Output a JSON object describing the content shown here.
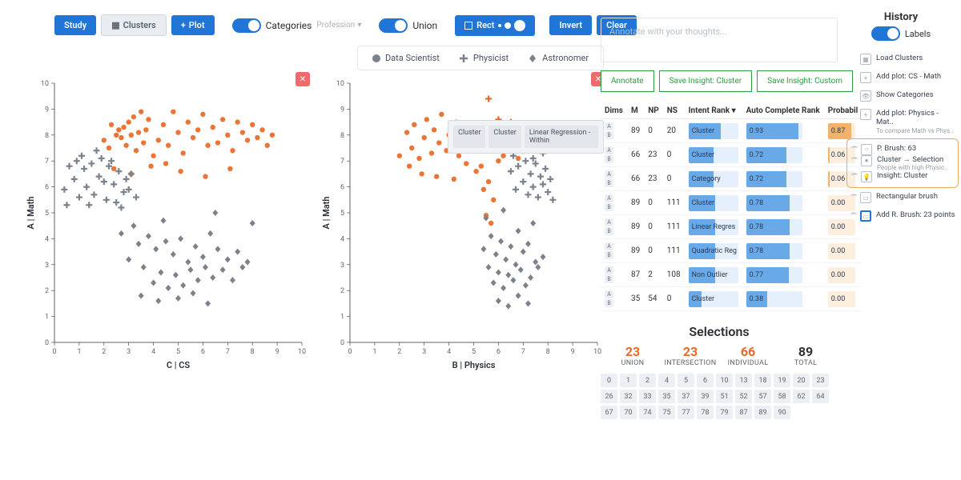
{
  "toolbar": {
    "study": "Study",
    "clusters": "Clusters",
    "plot": "Plot",
    "categories": "Categories",
    "profession": "Profession",
    "union": "Union",
    "rect": "Rect",
    "invert": "Invert",
    "clear": "Clear"
  },
  "legend": {
    "ds": "Data Scientist",
    "phys": "Physicist",
    "astro": "Astronomer"
  },
  "plots": {
    "left": {
      "ylabel": "A | Math",
      "xlabel": "C | CS"
    },
    "right": {
      "ylabel": "A | Math",
      "xlabel": "B | Physics"
    }
  },
  "plotTip": {
    "b1": "Cluster",
    "b2": "Cluster",
    "b3": "Linear Regression - Within"
  },
  "annotate": {
    "placeholder": "Annotate with your thoughts...",
    "b1": "Annotate",
    "b2": "Save Insight: Cluster",
    "b3": "Save Insight: Custom"
  },
  "tableHeaders": {
    "dims": "Dims",
    "m": "M",
    "np": "NP",
    "ns": "NS",
    "intent": "Intent Rank",
    "auto": "Auto Complete Rank",
    "prob": "Probabil"
  },
  "rows": [
    {
      "m": 89,
      "np": 0,
      "ns": 20,
      "intent": "Cluster",
      "auto": 0.93,
      "prob": 0.87
    },
    {
      "m": 66,
      "np": 23,
      "ns": 0,
      "intent": "Cluster",
      "auto": 0.72,
      "prob": 0.06
    },
    {
      "m": 66,
      "np": 23,
      "ns": 0,
      "intent": "Category",
      "auto": 0.72,
      "prob": 0.06
    },
    {
      "m": 89,
      "np": 0,
      "ns": 111,
      "intent": "Cluster",
      "auto": 0.78,
      "prob": 0.0
    },
    {
      "m": 89,
      "np": 0,
      "ns": 111,
      "intent": "Linear Regres",
      "auto": 0.78,
      "prob": 0.0
    },
    {
      "m": 89,
      "np": 0,
      "ns": 111,
      "intent": "Quadratic Reg",
      "auto": 0.78,
      "prob": 0.0
    },
    {
      "m": 87,
      "np": 2,
      "ns": 108,
      "intent": "Non Outlier",
      "auto": 0.77,
      "prob": 0.0
    },
    {
      "m": 35,
      "np": 54,
      "ns": 0,
      "intent": "Cluster",
      "auto": 0.38,
      "prob": 0.0
    }
  ],
  "selections": {
    "title": "Selections",
    "union": {
      "n": 23,
      "l": "UNION"
    },
    "intersection": {
      "n": 23,
      "l": "INTERSECTION"
    },
    "individual": {
      "n": 66,
      "l": "INDIVIDUAL"
    },
    "total": {
      "n": 89,
      "l": "TOTAL"
    }
  },
  "ids": [
    0,
    1,
    2,
    4,
    5,
    6,
    10,
    13,
    18,
    19,
    20,
    23,
    26,
    32,
    33,
    35,
    37,
    39,
    51,
    52,
    57,
    58,
    62,
    64,
    67,
    70,
    74,
    75,
    77,
    78,
    79,
    87,
    89,
    90
  ],
  "history": {
    "title": "History",
    "labels": "Labels",
    "items": [
      {
        "label": "Load Clusters",
        "sub": ""
      },
      {
        "label": "Add plot: CS - Math",
        "sub": ""
      },
      {
        "label": "Show Categories",
        "sub": ""
      },
      {
        "label": "Add plot: Physics - Mat..",
        "sub": "To compare Math vs Phys.."
      },
      {
        "label": "P. Brush: 63",
        "sub": ""
      },
      {
        "label": "Cluster → Selection",
        "sub": "People with high Physic.."
      },
      {
        "label": "Insight: Cluster",
        "sub": ""
      },
      {
        "label": "Rectangular brush",
        "sub": ""
      },
      {
        "label": "Add R. Brush: 23 points",
        "sub": ""
      }
    ]
  },
  "chart_data": [
    {
      "type": "scatter",
      "title": "",
      "xlabel": "C | CS",
      "ylabel": "A | Math",
      "xlim": [
        0,
        10
      ],
      "ylim": [
        0,
        10
      ],
      "series": [
        {
          "name": "Data Scientist",
          "glyph": "circle",
          "color": "#e96926",
          "selected": true,
          "points": [
            [
              2.2,
              7.5
            ],
            [
              2.5,
              8.0
            ],
            [
              2.6,
              8.2
            ],
            [
              2.7,
              7.9
            ],
            [
              2.8,
              8.3
            ],
            [
              2.9,
              7.6
            ],
            [
              3.0,
              8.5
            ],
            [
              3.1,
              8.0
            ],
            [
              3.2,
              8.7
            ],
            [
              3.3,
              7.4
            ],
            [
              3.4,
              8.1
            ],
            [
              3.5,
              8.9
            ],
            [
              3.6,
              7.7
            ],
            [
              3.7,
              8.2
            ],
            [
              3.8,
              8.6
            ],
            [
              4.0,
              7.2
            ],
            [
              4.2,
              7.8
            ],
            [
              4.4,
              8.4
            ],
            [
              4.6,
              7.6
            ],
            [
              4.8,
              8.9
            ],
            [
              5.0,
              8.1
            ],
            [
              5.2,
              7.3
            ],
            [
              5.4,
              8.5
            ],
            [
              5.6,
              7.9
            ],
            [
              5.8,
              8.2
            ],
            [
              6.0,
              8.8
            ],
            [
              6.2,
              7.6
            ],
            [
              6.4,
              8.3
            ],
            [
              6.6,
              7.7
            ],
            [
              6.8,
              8.6
            ],
            [
              7.0,
              8.0
            ],
            [
              7.2,
              7.4
            ],
            [
              7.4,
              8.5
            ],
            [
              7.6,
              8.1
            ],
            [
              7.8,
              7.8
            ],
            [
              8.0,
              8.4
            ],
            [
              8.2,
              7.9
            ],
            [
              8.4,
              8.2
            ],
            [
              8.6,
              7.6
            ],
            [
              3.9,
              6.8
            ],
            [
              3.1,
              6.5
            ],
            [
              2.4,
              6.7
            ],
            [
              5.1,
              6.6
            ],
            [
              6.1,
              6.4
            ],
            [
              7.1,
              6.7
            ],
            [
              4.5,
              6.9
            ],
            [
              2.0,
              7.8
            ],
            [
              2.3,
              8.4
            ],
            [
              8.8,
              8.0
            ]
          ]
        },
        {
          "name": "Physicist",
          "glyph": "plus",
          "color": "#7b828c",
          "selected": false,
          "points": [
            [
              0.4,
              5.9
            ],
            [
              0.8,
              6.3
            ],
            [
              1.0,
              5.6
            ],
            [
              1.2,
              6.7
            ],
            [
              1.3,
              6.0
            ],
            [
              1.5,
              6.9
            ],
            [
              1.6,
              5.7
            ],
            [
              1.8,
              6.4
            ],
            [
              1.9,
              7.1
            ],
            [
              2.0,
              6.2
            ],
            [
              2.1,
              5.5
            ],
            [
              2.2,
              6.8
            ],
            [
              2.4,
              6.1
            ],
            [
              2.5,
              5.4
            ],
            [
              2.6,
              6.6
            ],
            [
              2.8,
              5.8
            ],
            [
              2.9,
              6.3
            ],
            [
              3.0,
              5.9
            ],
            [
              3.1,
              6.5
            ],
            [
              3.3,
              5.6
            ],
            [
              0.6,
              6.8
            ],
            [
              1.1,
              7.2
            ],
            [
              1.4,
              5.3
            ],
            [
              1.7,
              7.4
            ],
            [
              2.3,
              7.0
            ],
            [
              2.7,
              5.2
            ],
            [
              0.5,
              5.3
            ],
            [
              0.9,
              7.0
            ]
          ]
        },
        {
          "name": "Astronomer",
          "glyph": "diamond",
          "color": "#7b828c",
          "selected": false,
          "points": [
            [
              2.7,
              4.2
            ],
            [
              3.0,
              3.2
            ],
            [
              3.2,
              4.5
            ],
            [
              3.4,
              3.8
            ],
            [
              3.6,
              2.9
            ],
            [
              3.8,
              4.1
            ],
            [
              4.0,
              2.3
            ],
            [
              4.1,
              3.6
            ],
            [
              4.3,
              2.7
            ],
            [
              4.5,
              3.9
            ],
            [
              4.6,
              2.1
            ],
            [
              4.8,
              3.4
            ],
            [
              4.9,
              2.6
            ],
            [
              5.1,
              4.0
            ],
            [
              5.2,
              2.2
            ],
            [
              5.4,
              3.1
            ],
            [
              5.5,
              2.8
            ],
            [
              5.7,
              3.7
            ],
            [
              5.8,
              2.4
            ],
            [
              6.0,
              3.3
            ],
            [
              6.1,
              2.9
            ],
            [
              6.3,
              4.2
            ],
            [
              6.4,
              2.5
            ],
            [
              6.6,
              3.6
            ],
            [
              6.8,
              2.8
            ],
            [
              7.0,
              3.2
            ],
            [
              7.2,
              2.4
            ],
            [
              7.4,
              3.5
            ],
            [
              7.6,
              2.9
            ],
            [
              7.8,
              3.1
            ],
            [
              8.0,
              4.6
            ],
            [
              3.5,
              1.8
            ],
            [
              4.2,
              1.6
            ],
            [
              5.0,
              1.7
            ],
            [
              5.6,
              1.9
            ],
            [
              6.2,
              1.5
            ],
            [
              4.4,
              4.7
            ],
            [
              6.5,
              5.0
            ]
          ]
        }
      ]
    },
    {
      "type": "scatter",
      "title": "",
      "xlabel": "B | Physics",
      "ylabel": "A | Math",
      "xlim": [
        0,
        10
      ],
      "ylim": [
        0,
        10
      ],
      "series": [
        {
          "name": "Data Scientist",
          "glyph": "circle",
          "color": "#e96926",
          "selected": true,
          "points": [
            [
              2.0,
              7.2
            ],
            [
              2.3,
              8.1
            ],
            [
              2.5,
              7.5
            ],
            [
              2.6,
              8.4
            ],
            [
              2.8,
              7.1
            ],
            [
              3.0,
              7.9
            ],
            [
              3.1,
              8.6
            ],
            [
              3.3,
              7.3
            ],
            [
              3.4,
              8.2
            ],
            [
              3.6,
              7.7
            ],
            [
              3.7,
              8.8
            ],
            [
              3.9,
              7.4
            ],
            [
              4.0,
              8.0
            ],
            [
              4.1,
              7.6
            ],
            [
              4.3,
              8.5
            ],
            [
              4.4,
              7.2
            ],
            [
              4.6,
              8.3
            ],
            [
              4.7,
              6.9
            ],
            [
              4.9,
              7.8
            ],
            [
              5.0,
              8.1
            ],
            [
              5.1,
              6.6
            ],
            [
              5.2,
              7.5
            ],
            [
              5.3,
              6.8
            ],
            [
              5.4,
              5.9
            ],
            [
              5.5,
              4.9
            ],
            [
              5.6,
              6.2
            ],
            [
              5.8,
              5.5
            ],
            [
              6.0,
              7.0
            ],
            [
              6.1,
              7.6
            ],
            [
              6.2,
              7.2
            ],
            [
              6.3,
              8.0
            ],
            [
              6.4,
              7.4
            ],
            [
              6.5,
              7.8
            ],
            [
              6.7,
              8.3
            ],
            [
              6.8,
              7.1
            ],
            [
              2.4,
              6.8
            ],
            [
              2.9,
              6.5
            ],
            [
              3.5,
              6.4
            ],
            [
              4.2,
              6.3
            ],
            [
              5.7,
              4.6
            ]
          ]
        },
        {
          "name": "Physicist",
          "glyph": "plus",
          "color": "#7b828c",
          "selected": false,
          "points": [
            [
              6.5,
              6.6
            ],
            [
              6.7,
              5.9
            ],
            [
              6.8,
              6.8
            ],
            [
              7.0,
              6.2
            ],
            [
              7.1,
              7.0
            ],
            [
              7.2,
              5.7
            ],
            [
              7.3,
              6.5
            ],
            [
              7.4,
              6.0
            ],
            [
              7.5,
              6.9
            ],
            [
              7.6,
              5.6
            ],
            [
              7.7,
              6.4
            ],
            [
              7.8,
              6.1
            ],
            [
              7.9,
              6.7
            ],
            [
              8.0,
              5.8
            ],
            [
              8.1,
              6.3
            ],
            [
              8.2,
              5.5
            ],
            [
              6.6,
              7.2
            ],
            [
              7.0,
              7.4
            ],
            [
              7.4,
              7.1
            ],
            [
              7.8,
              7.3
            ]
          ]
        },
        {
          "name": "Physicist-selected",
          "glyph": "plus",
          "color": "#e96926",
          "selected": true,
          "points": [
            [
              5.6,
              9.4
            ],
            [
              5.8,
              8.2
            ],
            [
              6.0,
              8.6
            ],
            [
              6.1,
              8.0
            ],
            [
              6.2,
              8.4
            ],
            [
              6.4,
              8.1
            ],
            [
              6.5,
              8.5
            ],
            [
              6.6,
              7.9
            ]
          ]
        },
        {
          "name": "Astronomer",
          "glyph": "diamond",
          "color": "#7b828c",
          "selected": false,
          "points": [
            [
              5.4,
              3.6
            ],
            [
              5.6,
              2.9
            ],
            [
              5.7,
              4.1
            ],
            [
              5.8,
              2.3
            ],
            [
              5.9,
              3.4
            ],
            [
              6.0,
              2.7
            ],
            [
              6.1,
              3.9
            ],
            [
              6.2,
              2.1
            ],
            [
              6.3,
              3.2
            ],
            [
              6.4,
              2.6
            ],
            [
              6.5,
              3.7
            ],
            [
              6.6,
              2.4
            ],
            [
              6.7,
              3.0
            ],
            [
              6.8,
              4.3
            ],
            [
              6.9,
              2.8
            ],
            [
              7.0,
              3.5
            ],
            [
              7.1,
              2.2
            ],
            [
              7.2,
              3.8
            ],
            [
              7.3,
              2.5
            ],
            [
              7.4,
              4.6
            ],
            [
              7.5,
              3.1
            ],
            [
              7.6,
              2.9
            ],
            [
              7.8,
              3.3
            ],
            [
              6.0,
              1.6
            ],
            [
              6.4,
              1.4
            ],
            [
              6.8,
              1.8
            ],
            [
              7.2,
              1.5
            ],
            [
              5.5,
              4.8
            ],
            [
              6.2,
              5.1
            ]
          ]
        }
      ]
    }
  ]
}
